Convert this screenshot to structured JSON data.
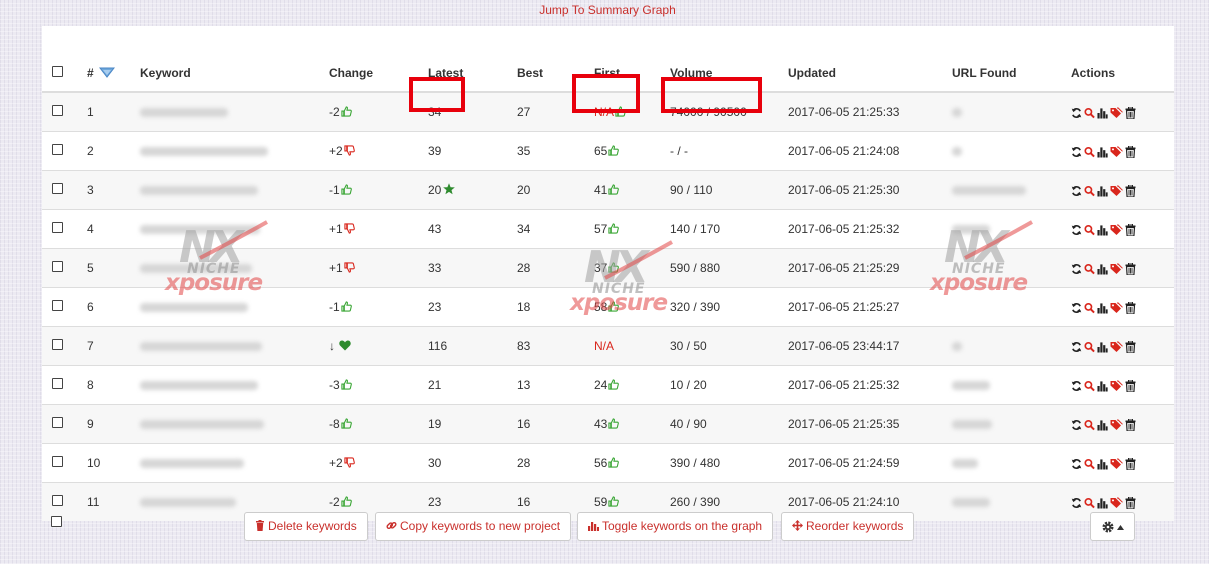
{
  "top_link": "Jump To Summary Graph",
  "columns": {
    "num": "#",
    "keyword": "Keyword",
    "change": "Change",
    "latest": "Latest",
    "best": "Best",
    "first": "First",
    "volume": "Volume",
    "updated": "Updated",
    "url_found": "URL Found",
    "actions": "Actions"
  },
  "rows": [
    {
      "num": "1",
      "change": "-2",
      "change_dir": "up",
      "latest": "34",
      "best": "27",
      "first": "N/A",
      "first_na": true,
      "volume": "74000 / 90500",
      "updated": "2017-06-05 21:25:33"
    },
    {
      "num": "2",
      "change": "+2",
      "change_dir": "down",
      "latest": "39",
      "best": "35",
      "first": "65",
      "first_na": false,
      "volume": "- / -",
      "updated": "2017-06-05 21:24:08"
    },
    {
      "num": "3",
      "change": "-1",
      "change_dir": "up",
      "latest": "20",
      "latest_star": true,
      "best": "20",
      "first": "41",
      "first_na": false,
      "volume": "90 / 110",
      "updated": "2017-06-05 21:25:30"
    },
    {
      "num": "4",
      "change": "+1",
      "change_dir": "down",
      "latest": "43",
      "best": "34",
      "first": "57",
      "first_na": false,
      "volume": "140 / 170",
      "updated": "2017-06-05 21:25:32"
    },
    {
      "num": "5",
      "change": "+1",
      "change_dir": "down",
      "latest": "33",
      "best": "28",
      "first": "37",
      "first_na": false,
      "volume": "590 / 880",
      "updated": "2017-06-05 21:25:29"
    },
    {
      "num": "6",
      "change": "-1",
      "change_dir": "up",
      "latest": "23",
      "best": "18",
      "first": "58",
      "first_na": false,
      "volume": "320 / 390",
      "updated": "2017-06-05 21:25:27"
    },
    {
      "num": "7",
      "change": "↓",
      "change_dir": "heart",
      "latest": "116",
      "best": "83",
      "first": "N/A",
      "first_na": true,
      "volume": "30 / 50",
      "updated": "2017-06-05 23:44:17"
    },
    {
      "num": "8",
      "change": "-3",
      "change_dir": "up",
      "latest": "21",
      "best": "13",
      "first": "24",
      "first_na": false,
      "volume": "10 / 20",
      "updated": "2017-06-05 21:25:32"
    },
    {
      "num": "9",
      "change": "-8",
      "change_dir": "up",
      "latest": "19",
      "best": "16",
      "first": "43",
      "first_na": false,
      "volume": "40 / 90",
      "updated": "2017-06-05 21:25:35"
    },
    {
      "num": "10",
      "change": "+2",
      "change_dir": "down",
      "latest": "30",
      "best": "28",
      "first": "56",
      "first_na": false,
      "volume": "390 / 480",
      "updated": "2017-06-05 21:24:59"
    },
    {
      "num": "11",
      "change": "-2",
      "change_dir": "up",
      "latest": "23",
      "best": "16",
      "first": "59",
      "first_na": false,
      "volume": "260 / 390",
      "updated": "2017-06-05 21:24:10"
    }
  ],
  "watermark": {
    "line1": "NX",
    "line2": "NICHE",
    "line3": "xposure"
  },
  "buttons": {
    "delete": "Delete keywords",
    "copy": "Copy keywords to new project",
    "toggle": "Toggle keywords on the graph",
    "reorder": "Reorder keywords"
  },
  "icons": {
    "sort": "sort-down-icon",
    "thumb_up": "thumbs-up-icon",
    "thumb_down": "thumbs-down-icon",
    "star": "star-icon",
    "heart": "heart-icon",
    "actions": [
      "refresh-icon",
      "search-icon",
      "bar-chart-icon",
      "tag-icon",
      "trash-icon"
    ],
    "gear": "gear-icon"
  },
  "colors": {
    "accent": "#c9302c",
    "up": "#3aa635",
    "down": "#d9261c",
    "highlight_box": "#e8000c"
  }
}
